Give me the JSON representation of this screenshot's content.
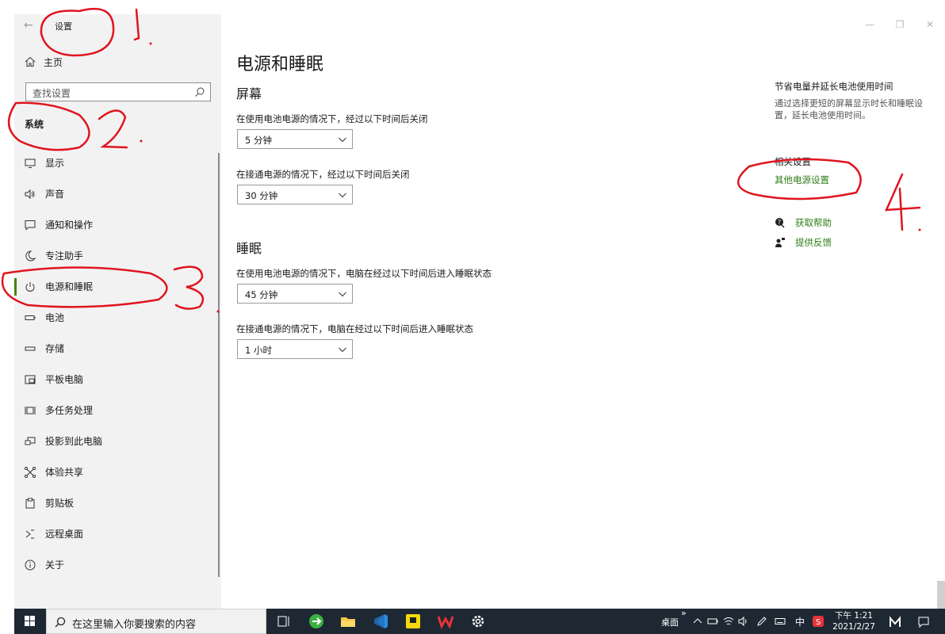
{
  "window": {
    "app_title": "设置",
    "back_icon": "back-arrow-icon"
  },
  "sidebar": {
    "home_label": "主页",
    "search_placeholder": "查找设置",
    "group_title": "系统",
    "items": [
      {
        "label": "显示",
        "icon": "display-icon"
      },
      {
        "label": "声音",
        "icon": "sound-icon"
      },
      {
        "label": "通知和操作",
        "icon": "notification-icon"
      },
      {
        "label": "专注助手",
        "icon": "moon-icon"
      },
      {
        "label": "电源和睡眠",
        "icon": "power-icon",
        "active": true
      },
      {
        "label": "电池",
        "icon": "battery-icon"
      },
      {
        "label": "存储",
        "icon": "storage-icon"
      },
      {
        "label": "平板电脑",
        "icon": "tablet-icon"
      },
      {
        "label": "多任务处理",
        "icon": "multitask-icon"
      },
      {
        "label": "投影到此电脑",
        "icon": "project-icon"
      },
      {
        "label": "体验共享",
        "icon": "share-icon"
      },
      {
        "label": "剪贴板",
        "icon": "clipboard-icon"
      },
      {
        "label": "远程桌面",
        "icon": "remote-desktop-icon"
      },
      {
        "label": "关于",
        "icon": "info-icon"
      }
    ]
  },
  "main": {
    "page_title": "电源和睡眠",
    "screen": {
      "title": "屏幕",
      "battery_label": "在使用电池电源的情况下，经过以下时间后关闭",
      "battery_value": "5 分钟",
      "plugged_label": "在接通电源的情况下，经过以下时间后关闭",
      "plugged_value": "30 分钟"
    },
    "sleep": {
      "title": "睡眠",
      "battery_label": "在使用电池电源的情况下，电脑在经过以下时间后进入睡眠状态",
      "battery_value": "45 分钟",
      "plugged_label": "在接通电源的情况下，电脑在经过以下时间后进入睡眠状态",
      "plugged_value": "1 小时"
    }
  },
  "side_panel": {
    "tip_title": "节省电量并延长电池使用时间",
    "tip_body": "通过选择更短的屏幕显示时长和睡眠设置，延长电池使用时间。",
    "related_title": "相关设置",
    "related_link": "其他电源设置",
    "help_label": "获取帮助",
    "feedback_label": "提供反馈"
  },
  "taskbar": {
    "search_placeholder": "在这里输入你要搜索的内容",
    "desktop_label": "桌面",
    "overflow": "»",
    "ime_label": "中",
    "time": "下午 1:21",
    "date": "2021/2/27"
  },
  "annotations": [
    "1.",
    "2.",
    "3.",
    "4."
  ],
  "colors": {
    "accent": "#498205",
    "link": "#2f7d1a",
    "annotation": "#e0141e",
    "taskbar": "#1e2833"
  }
}
